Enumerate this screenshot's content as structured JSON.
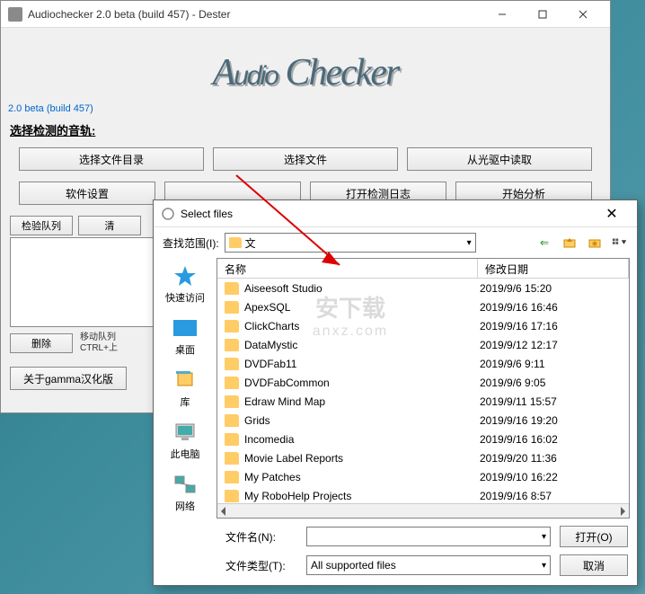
{
  "main_window": {
    "title": "Audiochecker 2.0 beta (build 457) - Dester",
    "logo": "Audio Checker",
    "version": "2.0 beta (build 457)",
    "section_label": "选择检测的音轨:",
    "buttons_row1": [
      "选择文件目录",
      "选择文件",
      "从光驱中读取"
    ],
    "buttons_row2": [
      "软件设置",
      "",
      "打开检测日志",
      "开始分析"
    ],
    "tab_check": "检验队列",
    "tab_clear": "清",
    "btn_delete": "删除",
    "hint": "移动队列\nCTRL+上",
    "about": "关于gamma汉化版"
  },
  "dialog": {
    "title": "Select files",
    "lookin_label": "查找范围(I):",
    "lookin_value": "文",
    "places": [
      "快速访问",
      "桌面",
      "库",
      "此电脑",
      "网络"
    ],
    "col_name": "名称",
    "col_date": "修改日期",
    "files": [
      {
        "name": "Aiseesoft Studio",
        "date": "2019/9/6 15:20"
      },
      {
        "name": "ApexSQL",
        "date": "2019/9/16 16:46"
      },
      {
        "name": "ClickCharts",
        "date": "2019/9/16 17:16"
      },
      {
        "name": "DataMystic",
        "date": "2019/9/12 12:17"
      },
      {
        "name": "DVDFab11",
        "date": "2019/9/6 9:11"
      },
      {
        "name": "DVDFabCommon",
        "date": "2019/9/6 9:05"
      },
      {
        "name": "Edraw Mind Map",
        "date": "2019/9/11 15:57"
      },
      {
        "name": "Grids",
        "date": "2019/9/16 19:20"
      },
      {
        "name": "Incomedia",
        "date": "2019/9/16 16:02"
      },
      {
        "name": "Movie Label Reports",
        "date": "2019/9/20 11:36"
      },
      {
        "name": "My Patches",
        "date": "2019/9/10 16:22"
      },
      {
        "name": "My RoboHelp Projects",
        "date": "2019/9/16 8:57"
      }
    ],
    "filename_label": "文件名(N):",
    "filetype_label": "文件类型(T):",
    "filetype_value": "All supported files",
    "open_btn": "打开(O)",
    "cancel_btn": "取消"
  },
  "watermark": {
    "line1": "安下载",
    "line2": "anxz.com"
  }
}
